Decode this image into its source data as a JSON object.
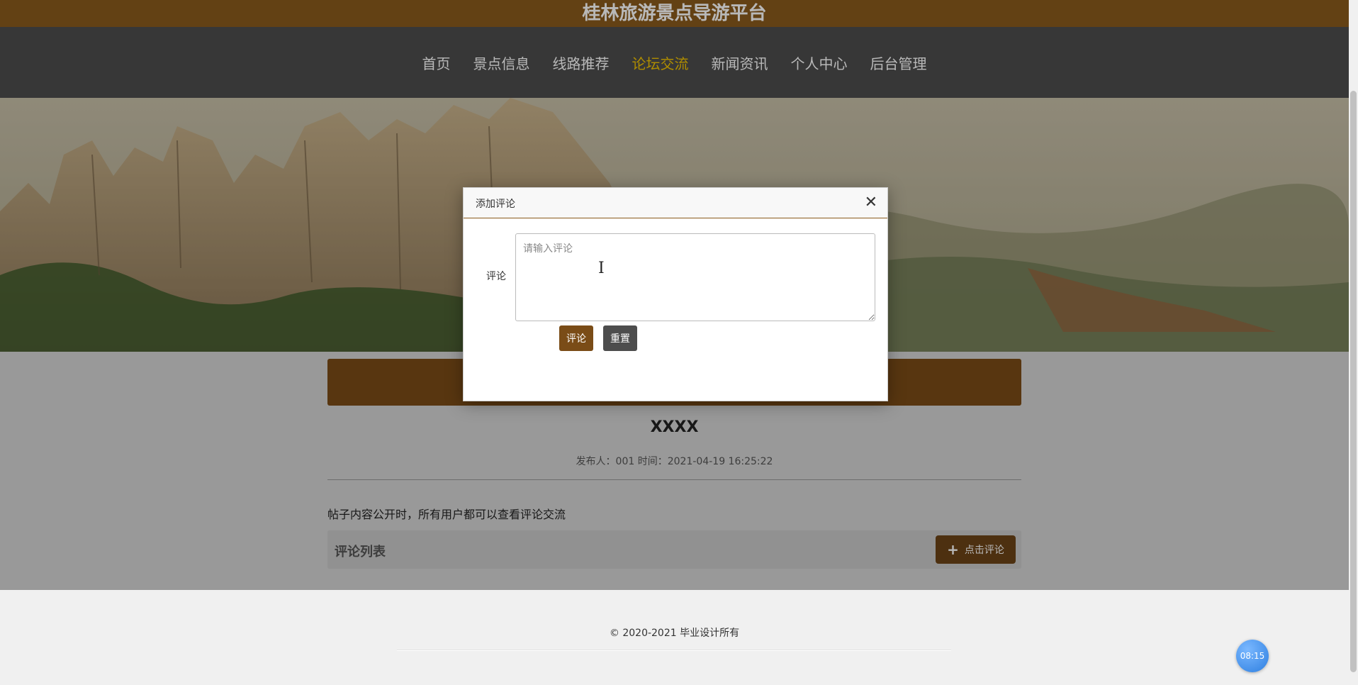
{
  "site": {
    "title": "桂林旅游景点导游平台"
  },
  "nav": {
    "items": [
      {
        "label": "首页"
      },
      {
        "label": "景点信息"
      },
      {
        "label": "线路推荐"
      },
      {
        "label": "论坛交流"
      },
      {
        "label": "新闻资讯"
      },
      {
        "label": "个人中心"
      },
      {
        "label": "后台管理"
      }
    ],
    "active_index": 3,
    "active_color": "#f2c200"
  },
  "post": {
    "title": "XXXX",
    "meta": "发布人：001 时间：2021-04-19 16:25:22",
    "body": "帖子内容公开时，所有用户都可以查看评论交流"
  },
  "comments": {
    "heading": "评论列表",
    "add_button": "点击评论",
    "add_icon": "plus-icon"
  },
  "modal": {
    "title": "添加评论",
    "close_icon": "close-icon",
    "field_label": "评论",
    "placeholder": "请输入评论",
    "value": "",
    "submit_label": "评论",
    "reset_label": "重置"
  },
  "footer": {
    "copyright": "© 2020-2021 毕业设计所有"
  },
  "clock": {
    "time": "08:15"
  },
  "colors": {
    "brand_brown": "#8a5a1c",
    "nav_bg": "#4d4d4d",
    "button_brown": "#7a4c17"
  }
}
